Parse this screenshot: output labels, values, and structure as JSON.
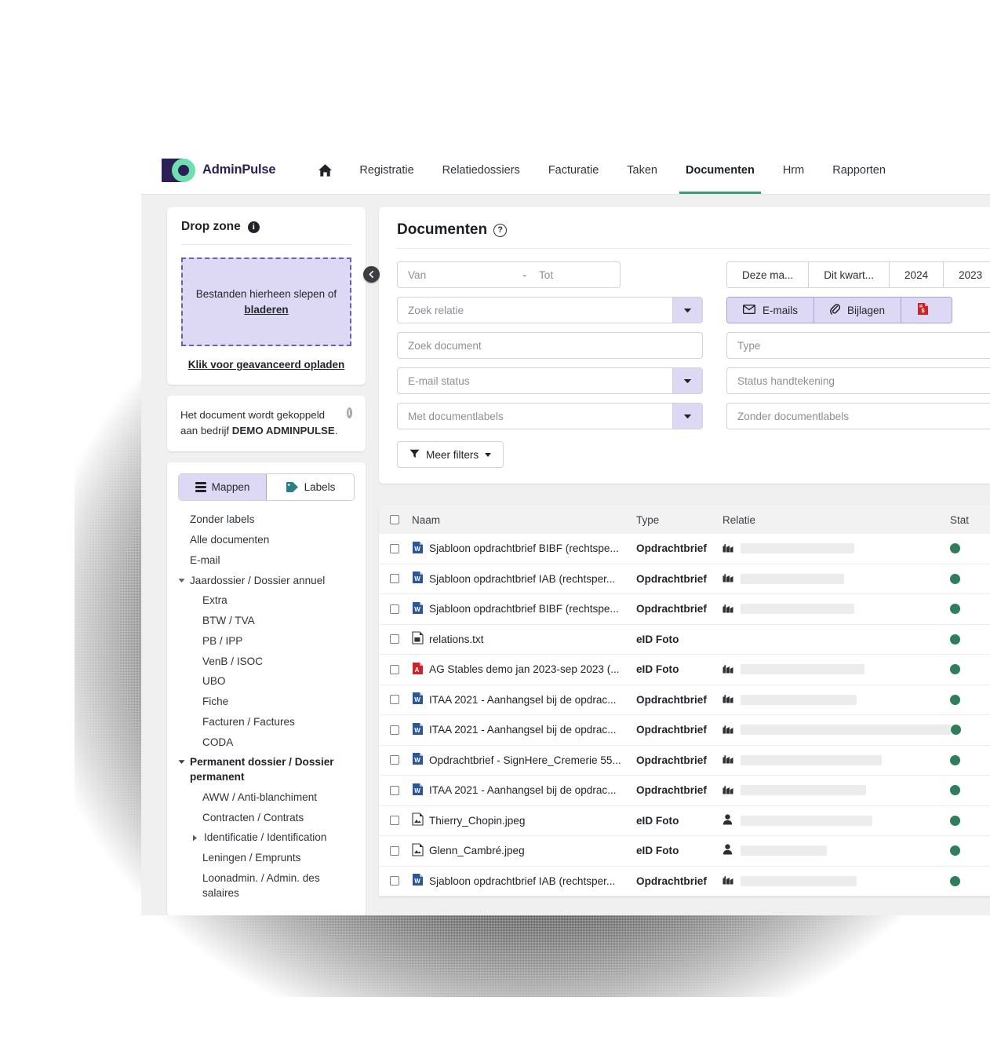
{
  "brand": {
    "name": "AdminPulse"
  },
  "topnav": {
    "home_icon": "home-icon",
    "items": [
      {
        "label": "Registratie",
        "active": false
      },
      {
        "label": "Relatiedossiers",
        "active": false
      },
      {
        "label": "Facturatie",
        "active": false
      },
      {
        "label": "Taken",
        "active": false
      },
      {
        "label": "Documenten",
        "active": true
      },
      {
        "label": "Hrm",
        "active": false
      },
      {
        "label": "Rapporten",
        "active": false
      }
    ]
  },
  "sidebar": {
    "dropzone": {
      "title": "Drop zone",
      "info_icon": "info-icon",
      "box_text": "Bestanden hierheen slepen of",
      "box_link": "bladeren",
      "advanced_link": "Klik voor geavanceerd opladen"
    },
    "notice": {
      "text_part1": "Het document wordt gekoppeld aan bedrijf ",
      "company": "DEMO ADMINPULSE",
      "text_part2": ".",
      "full": "Het document wordt gekoppeld aan bedrijf DEMO ADMINPULSE.",
      "info_icon": "info-icon"
    },
    "toggle": {
      "folders_label": "Mappen",
      "labels_label": "Labels",
      "active": "Mappen"
    },
    "tree": [
      {
        "label": "Zonder labels",
        "level": 0,
        "caret": "none",
        "bold": false
      },
      {
        "label": "Alle documenten",
        "level": 0,
        "caret": "none",
        "bold": false
      },
      {
        "label": "E-mail",
        "level": 0,
        "caret": "none",
        "bold": false
      },
      {
        "label": "Jaardossier / Dossier annuel",
        "level": 0,
        "caret": "down",
        "bold": false
      },
      {
        "label": "Extra",
        "level": 1,
        "caret": "none",
        "bold": false
      },
      {
        "label": "BTW / TVA",
        "level": 1,
        "caret": "none",
        "bold": false
      },
      {
        "label": "PB / IPP",
        "level": 1,
        "caret": "none",
        "bold": false
      },
      {
        "label": "VenB / ISOC",
        "level": 1,
        "caret": "none",
        "bold": false
      },
      {
        "label": "UBO",
        "level": 1,
        "caret": "none",
        "bold": false
      },
      {
        "label": "Fiche",
        "level": 1,
        "caret": "none",
        "bold": false
      },
      {
        "label": "Facturen / Factures",
        "level": 1,
        "caret": "none",
        "bold": false
      },
      {
        "label": "CODA",
        "level": 1,
        "caret": "none",
        "bold": false
      },
      {
        "label": "Permanent dossier / Dossier permanent",
        "level": 0,
        "caret": "down",
        "bold": true
      },
      {
        "label": "AWW / Anti-blanchiment",
        "level": 1,
        "caret": "none",
        "bold": false
      },
      {
        "label": "Contracten / Contrats",
        "level": 1,
        "caret": "none",
        "bold": false
      },
      {
        "label": "Identificatie / Identification",
        "level": 1,
        "caret": "right",
        "bold": false
      },
      {
        "label": "Leningen / Emprunts",
        "level": 1,
        "caret": "none",
        "bold": false
      },
      {
        "label": "Loonadmin. / Admin. des salaires",
        "level": 1,
        "caret": "none",
        "bold": false
      }
    ],
    "collapse_icon": "chevron-left-icon"
  },
  "main": {
    "title": "Documenten",
    "help_icon": "question-mark-icon",
    "date_range": {
      "from_placeholder": "Van",
      "separator": "-",
      "to_placeholder": "Tot"
    },
    "period_buttons": [
      {
        "label": "Deze ma..."
      },
      {
        "label": "Dit kwart..."
      },
      {
        "label": "2024"
      },
      {
        "label": "2023"
      }
    ],
    "doc_type_buttons": [
      {
        "label": "E-mails",
        "icon": "envelope-icon"
      },
      {
        "label": "Bijlagen",
        "icon": "paperclip-icon"
      },
      {
        "label": "",
        "icon": "pdf-document-icon"
      }
    ],
    "fields": {
      "relatie_placeholder": "Zoek relatie",
      "document_placeholder": "Zoek document",
      "email_status_placeholder": "E-mail status",
      "met_labels_placeholder": "Met documentlabels",
      "type_placeholder": "Type",
      "status_handtekening_placeholder": "Status handtekening",
      "zonder_labels_placeholder": "Zonder documentlabels"
    },
    "more_filters_label": "Meer filters",
    "more_filters_icon": "filter-icon"
  },
  "table": {
    "columns": [
      {
        "label": "",
        "key": "check"
      },
      {
        "label": "Naam",
        "key": "naam"
      },
      {
        "label": "Type",
        "key": "type"
      },
      {
        "label": "Relatie",
        "key": "relatie"
      },
      {
        "label": "Stat",
        "key": "status"
      }
    ],
    "rows": [
      {
        "naam": "Sjabloon opdrachtbrief BIBF (rechtspe...",
        "icon": "word-document-icon",
        "type": "Opdrachtbrief",
        "rel_icon": "company-icon",
        "rel_width": 145,
        "status": "green"
      },
      {
        "naam": "Sjabloon opdrachtbrief IAB (rechtsper...",
        "icon": "word-document-icon",
        "type": "Opdrachtbrief",
        "rel_icon": "company-icon",
        "rel_width": 132,
        "status": "green"
      },
      {
        "naam": "Sjabloon opdrachtbrief BIBF (rechtspe...",
        "icon": "word-document-icon",
        "type": "Opdrachtbrief",
        "rel_icon": "company-icon",
        "rel_width": 145,
        "status": "green"
      },
      {
        "naam": "relations.txt",
        "icon": "text-document-icon",
        "type": "eID Foto",
        "rel_icon": "none",
        "rel_width": 0,
        "status": "green"
      },
      {
        "naam": "AG Stables demo jan 2023-sep 2023 (...",
        "icon": "pdf-document-icon",
        "type": "eID Foto",
        "rel_icon": "company-icon",
        "rel_width": 158,
        "status": "green"
      },
      {
        "naam": "ITAA 2021 - Aanhangsel bij de opdrac...",
        "icon": "word-document-icon",
        "type": "Opdrachtbrief",
        "rel_icon": "company-icon",
        "rel_width": 148,
        "status": "green"
      },
      {
        "naam": "ITAA 2021 - Aanhangsel bij de opdrac...",
        "icon": "word-document-icon",
        "type": "Opdrachtbrief",
        "rel_icon": "company-icon",
        "rel_width": 268,
        "status": "green"
      },
      {
        "naam": "Opdrachtbrief - SignHere_Cremerie 55...",
        "icon": "word-document-icon",
        "type": "Opdrachtbrief",
        "rel_icon": "company-icon",
        "rel_width": 180,
        "status": "green"
      },
      {
        "naam": "ITAA 2021 - Aanhangsel bij de opdrac...",
        "icon": "word-document-icon",
        "type": "Opdrachtbrief",
        "rel_icon": "company-icon",
        "rel_width": 160,
        "status": "green"
      },
      {
        "naam": "Thierry_Chopin.jpeg",
        "icon": "image-document-icon",
        "type": "eID Foto",
        "rel_icon": "person-icon",
        "rel_width": 168,
        "status": "green"
      },
      {
        "naam": "Glenn_Cambré.jpeg",
        "icon": "image-document-icon",
        "type": "eID Foto",
        "rel_icon": "person-icon",
        "rel_width": 110,
        "status": "green"
      },
      {
        "naam": "Sjabloon opdrachtbrief IAB (rechtsper...",
        "icon": "word-document-icon",
        "type": "Opdrachtbrief",
        "rel_icon": "company-icon",
        "rel_width": 148,
        "status": "green"
      }
    ]
  },
  "colors": {
    "brand_navy": "#2b1f55",
    "brand_mint": "#6fdfb0",
    "accent_purple": "#ddd9f5",
    "accent_purple_border": "#a99fdb",
    "active_tab_underline": "#3c9c78",
    "status_green": "#2f7d5b",
    "word_blue": "#2b579a",
    "pdf_red": "#cc2229",
    "teal_tag": "#2a7f86"
  }
}
